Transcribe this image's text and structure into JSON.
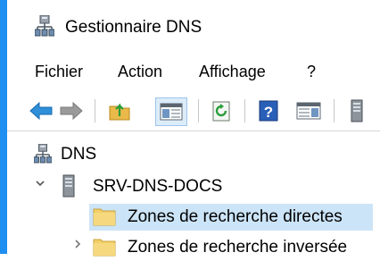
{
  "window": {
    "title": "Gestionnaire DNS",
    "accent_color": "#1e8ff0"
  },
  "menu": {
    "items": [
      {
        "label": "Fichier"
      },
      {
        "label": "Action"
      },
      {
        "label": "Affichage"
      },
      {
        "label": "?"
      }
    ]
  },
  "toolbar": {
    "buttons": [
      {
        "icon": "back-arrow-icon"
      },
      {
        "icon": "forward-arrow-icon"
      },
      {
        "icon": "up-folder-icon"
      },
      {
        "icon": "show-hide-console-tree-icon"
      },
      {
        "icon": "refresh-icon"
      },
      {
        "icon": "help-icon"
      },
      {
        "icon": "show-hide-action-pane-icon"
      },
      {
        "icon": "server-icon"
      }
    ]
  },
  "tree": {
    "root": {
      "label": "DNS",
      "icon": "dns-icon"
    },
    "server": {
      "label": "SRV-DNS-DOCS",
      "icon": "server-icon",
      "expanded": true
    },
    "children": [
      {
        "label": "Zones de recherche directes",
        "icon": "folder-icon",
        "selected": true
      },
      {
        "label": "Zones de recherche inversée",
        "icon": "folder-icon",
        "selected": false
      }
    ],
    "selection_color": "#cce4f7"
  }
}
